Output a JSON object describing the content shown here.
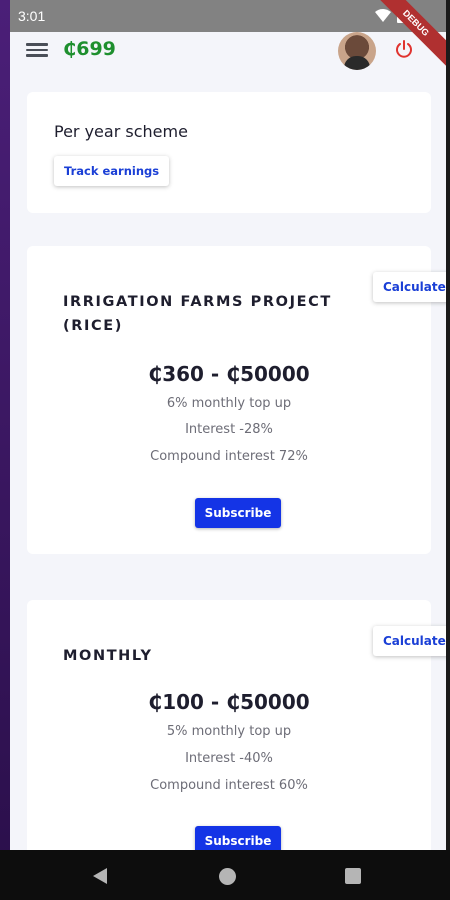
{
  "status_bar": {
    "time": "3:01",
    "debug_label": "DEBUG"
  },
  "app_bar": {
    "balance": "₵699"
  },
  "scheme_card": {
    "title": "Per year scheme",
    "track_label": "Track earnings"
  },
  "plans": [
    {
      "title": "IRRIGATION FARMS PROJECT (RICE)",
      "range": "₵360 - ₵50000",
      "details": [
        "6% monthly top up",
        "Interest -28%",
        "Compound interest 72%"
      ],
      "subscribe_label": "Subscribe",
      "calculate_label": "Calculate"
    },
    {
      "title": "MONTHLY",
      "range": "₵100 - ₵50000",
      "details": [
        "5% monthly top up",
        "Interest -40%",
        "Compound interest 60%"
      ],
      "subscribe_label": "Subscribe",
      "calculate_label": "Calculate"
    }
  ],
  "colors": {
    "accent": "#1434e6",
    "balance": "#1e8f2e",
    "power": "#e0332f"
  }
}
